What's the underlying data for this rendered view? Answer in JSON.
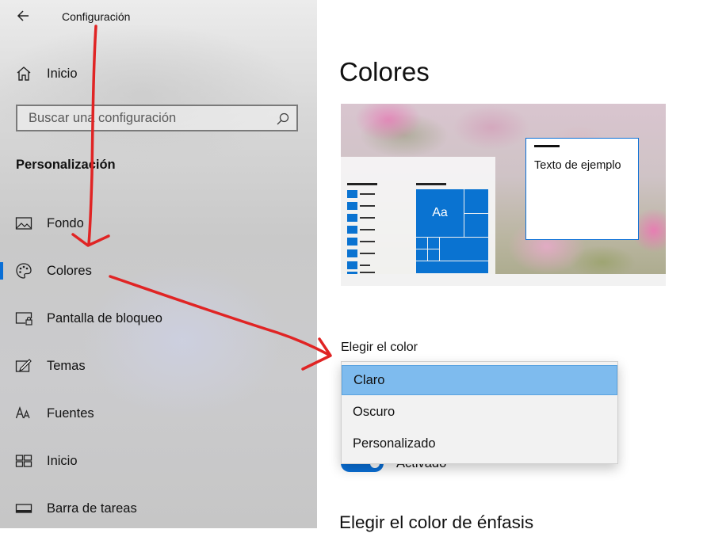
{
  "app": {
    "title": "Configuración"
  },
  "sidebar": {
    "home_label": "Inicio",
    "search": {
      "placeholder": "Buscar una configuración"
    },
    "section_heading": "Personalización",
    "items": [
      {
        "label": "Fondo",
        "icon": "image-icon"
      },
      {
        "label": "Colores",
        "icon": "palette-icon",
        "selected": true
      },
      {
        "label": "Pantalla de bloqueo",
        "icon": "lock-screen-icon"
      },
      {
        "label": "Temas",
        "icon": "themes-icon"
      },
      {
        "label": "Fuentes",
        "icon": "fonts-icon"
      },
      {
        "label": "Inicio",
        "icon": "start-icon"
      },
      {
        "label": "Barra de tareas",
        "icon": "taskbar-icon"
      }
    ]
  },
  "main": {
    "title": "Colores",
    "preview": {
      "tile_text": "Aa",
      "sample_text": "Texto de ejemplo"
    },
    "choose_color_label": "Elegir el color",
    "dropdown": {
      "options": [
        "Claro",
        "Oscuro",
        "Personalizado"
      ],
      "selected": "Claro"
    },
    "transparency_toggle": {
      "state_label": "Activado",
      "on": true
    },
    "accent_heading": "Elegir el color de énfasis"
  },
  "colors": {
    "accent": "#0a6fd6",
    "annotation": "#e02424",
    "dropdown_highlight": "#7ebbee"
  }
}
